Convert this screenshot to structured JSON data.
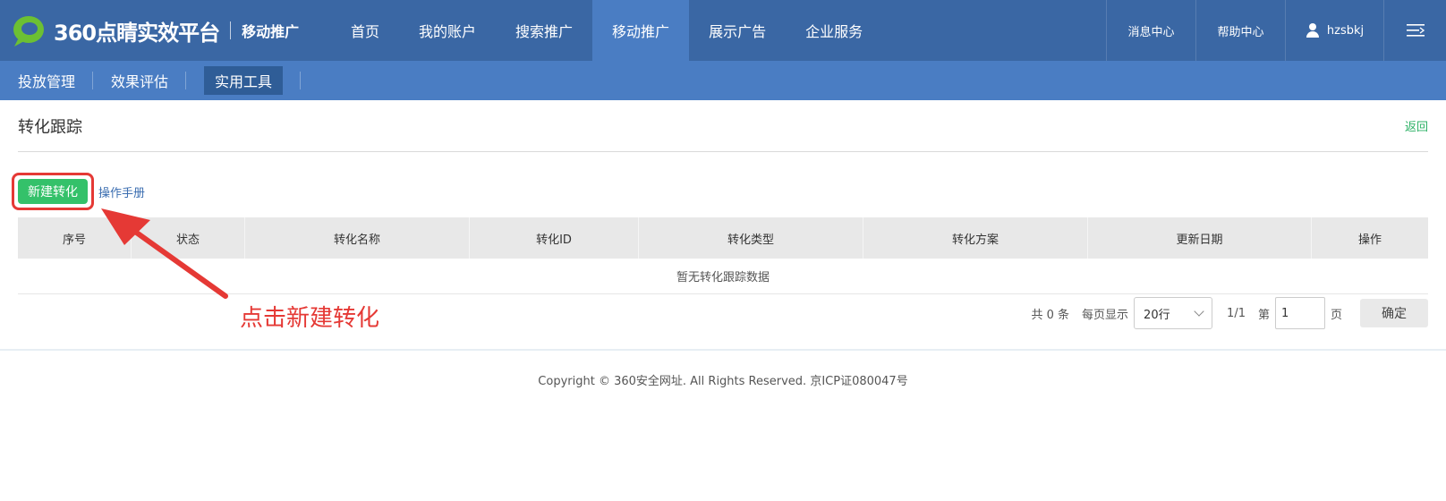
{
  "brand": {
    "name": "360点睛实效平台",
    "product": "移动推广",
    "logo_color": "#5cb531"
  },
  "top_nav": {
    "items": [
      {
        "label": "首页",
        "active": false
      },
      {
        "label": "我的账户",
        "active": false
      },
      {
        "label": "搜索推广",
        "active": false
      },
      {
        "label": "移动推广",
        "active": true
      },
      {
        "label": "展示广告",
        "active": false
      },
      {
        "label": "企业服务",
        "active": false
      }
    ],
    "message_center": "消息中心",
    "help_center": "帮助中心",
    "username": "hzsbkj",
    "menu_icon": "hamburger-icon"
  },
  "sub_nav": {
    "items": [
      {
        "label": "投放管理",
        "active": false
      },
      {
        "label": "效果评估",
        "active": false
      },
      {
        "label": "实用工具",
        "active": true
      }
    ]
  },
  "page": {
    "title": "转化跟踪",
    "back_label": "返回",
    "new_button_label": "新建转化",
    "manual_link": "操作手册"
  },
  "table": {
    "columns": [
      "序号",
      "状态",
      "转化名称",
      "转化ID",
      "转化类型",
      "转化方案",
      "更新日期",
      "操作"
    ],
    "empty_text": "暂无转化跟踪数据"
  },
  "pagination": {
    "total_text": "共 0 条",
    "per_page_label": "每页显示",
    "per_page_value": "20行",
    "page_status": "1/1",
    "goto_prefix": "第",
    "page_input_value": "1",
    "goto_suffix": "页",
    "confirm_label": "确定"
  },
  "footer": {
    "copyright": "Copyright © 360安全网址. All Rights Reserved. 京ICP证080047号"
  },
  "annotation": {
    "text": "点击新建转化",
    "color": "#e53935"
  },
  "colors": {
    "top_bar": "#3a67a4",
    "sub_bar": "#4a7dc3",
    "accent_green": "#34c16a"
  }
}
